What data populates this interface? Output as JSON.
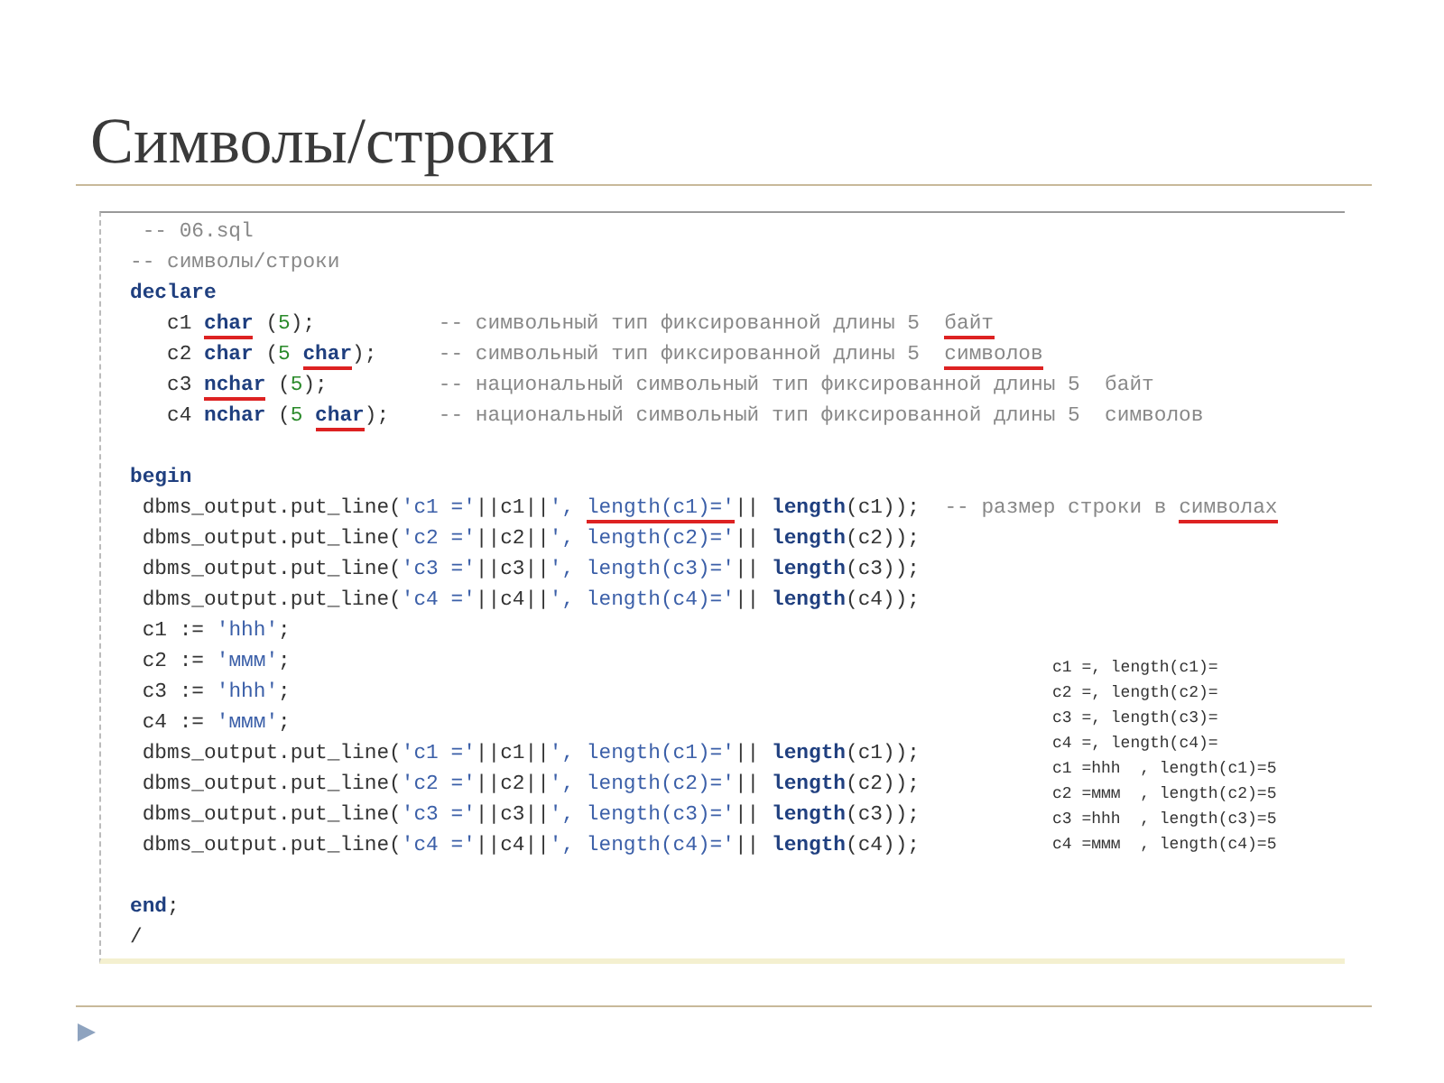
{
  "slide_title": "Символы/строки",
  "code_blocks": [
    {
      "lines": [
        {
          "tokens": [
            {
              "kind": "comment",
              "text": " -- 06.sql",
              "underlined": false
            }
          ]
        },
        {
          "tokens": [
            {
              "kind": "comment",
              "text": "-- символы/строки",
              "underlined": false
            }
          ]
        },
        {
          "tokens": [
            {
              "kind": "keyword",
              "text": "declare",
              "underlined": false
            }
          ]
        },
        {
          "tokens": [
            {
              "kind": "plain",
              "text": "   c1 ",
              "underlined": false
            },
            {
              "kind": "keyword",
              "text": "char",
              "underlined": true
            },
            {
              "kind": "plain",
              "text": " (",
              "underlined": false
            },
            {
              "kind": "number",
              "text": "5",
              "underlined": false
            },
            {
              "kind": "plain",
              "text": ");          ",
              "underlined": false
            },
            {
              "kind": "comment",
              "text": "-- символьный тип фиксированной длины 5  ",
              "underlined": false
            },
            {
              "kind": "comment",
              "text": "байт",
              "underlined": true
            }
          ]
        },
        {
          "tokens": [
            {
              "kind": "plain",
              "text": "   c2 ",
              "underlined": false
            },
            {
              "kind": "keyword",
              "text": "char",
              "underlined": false
            },
            {
              "kind": "plain",
              "text": " (",
              "underlined": false
            },
            {
              "kind": "number",
              "text": "5 ",
              "underlined": false
            },
            {
              "kind": "keyword",
              "text": "char",
              "underlined": true
            },
            {
              "kind": "plain",
              "text": ");     ",
              "underlined": false
            },
            {
              "kind": "comment",
              "text": "-- символьный тип фиксированной длины 5  ",
              "underlined": false
            },
            {
              "kind": "comment",
              "text": "символов",
              "underlined": true
            }
          ]
        },
        {
          "tokens": [
            {
              "kind": "plain",
              "text": "   c3 ",
              "underlined": false
            },
            {
              "kind": "keyword",
              "text": "nchar",
              "underlined": true
            },
            {
              "kind": "plain",
              "text": " (",
              "underlined": false
            },
            {
              "kind": "number",
              "text": "5",
              "underlined": false
            },
            {
              "kind": "plain",
              "text": ");         ",
              "underlined": false
            },
            {
              "kind": "comment",
              "text": "-- национальный символьный тип фиксированной длины 5  байт",
              "underlined": false
            }
          ]
        },
        {
          "tokens": [
            {
              "kind": "plain",
              "text": "   c4 ",
              "underlined": false
            },
            {
              "kind": "keyword",
              "text": "nchar",
              "underlined": false
            },
            {
              "kind": "plain",
              "text": " (",
              "underlined": false
            },
            {
              "kind": "number",
              "text": "5 ",
              "underlined": false
            },
            {
              "kind": "keyword",
              "text": "char",
              "underlined": true
            },
            {
              "kind": "plain",
              "text": ");    ",
              "underlined": false
            },
            {
              "kind": "comment",
              "text": "-- национальный символьный тип фиксированной длины 5  символов",
              "underlined": false
            }
          ]
        }
      ]
    },
    {
      "lines": [
        {
          "tokens": [
            {
              "kind": "keyword",
              "text": "begin",
              "underlined": false
            }
          ]
        },
        {
          "tokens": [
            {
              "kind": "plain",
              "text": " dbms_output.put_line(",
              "underlined": false
            },
            {
              "kind": "string",
              "text": "'c1 ='",
              "underlined": false
            },
            {
              "kind": "plain",
              "text": "||c1||",
              "underlined": false
            },
            {
              "kind": "string",
              "text": "', ",
              "underlined": false
            },
            {
              "kind": "string",
              "text": "length(c1)='",
              "underlined": true
            },
            {
              "kind": "plain",
              "text": "|| ",
              "underlined": false
            },
            {
              "kind": "keyword",
              "text": "length",
              "underlined": false
            },
            {
              "kind": "plain",
              "text": "(c1));  ",
              "underlined": false
            },
            {
              "kind": "comment",
              "text": "-- размер строки в ",
              "underlined": false
            },
            {
              "kind": "comment",
              "text": "символах",
              "underlined": true
            }
          ]
        },
        {
          "tokens": [
            {
              "kind": "plain",
              "text": " dbms_output.put_line(",
              "underlined": false
            },
            {
              "kind": "string",
              "text": "'c2 ='",
              "underlined": false
            },
            {
              "kind": "plain",
              "text": "||c2||",
              "underlined": false
            },
            {
              "kind": "string",
              "text": "', length(c2)='",
              "underlined": false
            },
            {
              "kind": "plain",
              "text": "|| ",
              "underlined": false
            },
            {
              "kind": "keyword",
              "text": "length",
              "underlined": false
            },
            {
              "kind": "plain",
              "text": "(c2));",
              "underlined": false
            }
          ]
        },
        {
          "tokens": [
            {
              "kind": "plain",
              "text": " dbms_output.put_line(",
              "underlined": false
            },
            {
              "kind": "string",
              "text": "'c3 ='",
              "underlined": false
            },
            {
              "kind": "plain",
              "text": "||c3||",
              "underlined": false
            },
            {
              "kind": "string",
              "text": "', length(c3)='",
              "underlined": false
            },
            {
              "kind": "plain",
              "text": "|| ",
              "underlined": false
            },
            {
              "kind": "keyword",
              "text": "length",
              "underlined": false
            },
            {
              "kind": "plain",
              "text": "(c3));",
              "underlined": false
            }
          ]
        },
        {
          "tokens": [
            {
              "kind": "plain",
              "text": " dbms_output.put_line(",
              "underlined": false
            },
            {
              "kind": "string",
              "text": "'c4 ='",
              "underlined": false
            },
            {
              "kind": "plain",
              "text": "||c4||",
              "underlined": false
            },
            {
              "kind": "string",
              "text": "', length(c4)='",
              "underlined": false
            },
            {
              "kind": "plain",
              "text": "|| ",
              "underlined": false
            },
            {
              "kind": "keyword",
              "text": "length",
              "underlined": false
            },
            {
              "kind": "plain",
              "text": "(c4));",
              "underlined": false
            }
          ]
        },
        {
          "tokens": [
            {
              "kind": "plain",
              "text": " c1 := ",
              "underlined": false
            },
            {
              "kind": "string",
              "text": "'hhh'",
              "underlined": false
            },
            {
              "kind": "plain",
              "text": ";",
              "underlined": false
            }
          ]
        },
        {
          "tokens": [
            {
              "kind": "plain",
              "text": " c2 := ",
              "underlined": false
            },
            {
              "kind": "string",
              "text": "'ммм'",
              "underlined": false
            },
            {
              "kind": "plain",
              "text": ";",
              "underlined": false
            }
          ]
        },
        {
          "tokens": [
            {
              "kind": "plain",
              "text": " c3 := ",
              "underlined": false
            },
            {
              "kind": "string",
              "text": "'hhh'",
              "underlined": false
            },
            {
              "kind": "plain",
              "text": ";",
              "underlined": false
            }
          ]
        },
        {
          "tokens": [
            {
              "kind": "plain",
              "text": " c4 := ",
              "underlined": false
            },
            {
              "kind": "string",
              "text": "'ммм'",
              "underlined": false
            },
            {
              "kind": "plain",
              "text": ";",
              "underlined": false
            }
          ]
        },
        {
          "tokens": [
            {
              "kind": "plain",
              "text": " dbms_output.put_line(",
              "underlined": false
            },
            {
              "kind": "string",
              "text": "'c1 ='",
              "underlined": false
            },
            {
              "kind": "plain",
              "text": "||c1||",
              "underlined": false
            },
            {
              "kind": "string",
              "text": "', length(c1)='",
              "underlined": false
            },
            {
              "kind": "plain",
              "text": "|| ",
              "underlined": false
            },
            {
              "kind": "keyword",
              "text": "length",
              "underlined": false
            },
            {
              "kind": "plain",
              "text": "(c1));",
              "underlined": false
            }
          ]
        },
        {
          "tokens": [
            {
              "kind": "plain",
              "text": " dbms_output.put_line(",
              "underlined": false
            },
            {
              "kind": "string",
              "text": "'c2 ='",
              "underlined": false
            },
            {
              "kind": "plain",
              "text": "||c2||",
              "underlined": false
            },
            {
              "kind": "string",
              "text": "', length(c2)='",
              "underlined": false
            },
            {
              "kind": "plain",
              "text": "|| ",
              "underlined": false
            },
            {
              "kind": "keyword",
              "text": "length",
              "underlined": false
            },
            {
              "kind": "plain",
              "text": "(c2));",
              "underlined": false
            }
          ]
        },
        {
          "tokens": [
            {
              "kind": "plain",
              "text": " dbms_output.put_line(",
              "underlined": false
            },
            {
              "kind": "string",
              "text": "'c3 ='",
              "underlined": false
            },
            {
              "kind": "plain",
              "text": "||c3||",
              "underlined": false
            },
            {
              "kind": "string",
              "text": "', length(c3)='",
              "underlined": false
            },
            {
              "kind": "plain",
              "text": "|| ",
              "underlined": false
            },
            {
              "kind": "keyword",
              "text": "length",
              "underlined": false
            },
            {
              "kind": "plain",
              "text": "(c3));",
              "underlined": false
            }
          ]
        },
        {
          "tokens": [
            {
              "kind": "plain",
              "text": " dbms_output.put_line(",
              "underlined": false
            },
            {
              "kind": "string",
              "text": "'c4 ='",
              "underlined": false
            },
            {
              "kind": "plain",
              "text": "||c4||",
              "underlined": false
            },
            {
              "kind": "string",
              "text": "', length(c4)='",
              "underlined": false
            },
            {
              "kind": "plain",
              "text": "|| ",
              "underlined": false
            },
            {
              "kind": "keyword",
              "text": "length",
              "underlined": false
            },
            {
              "kind": "plain",
              "text": "(c4));",
              "underlined": false
            }
          ]
        }
      ]
    },
    {
      "lines": [
        {
          "tokens": [
            {
              "kind": "keyword",
              "text": "end",
              "underlined": false
            },
            {
              "kind": "plain",
              "text": ";",
              "underlined": false
            }
          ]
        },
        {
          "tokens": [
            {
              "kind": "plain",
              "text": "/",
              "underlined": false
            }
          ]
        }
      ]
    }
  ],
  "output_lines": [
    "c1 =, length(c1)=",
    "c2 =, length(c2)=",
    "c3 =, length(c3)=",
    "c4 =, length(c4)=",
    "c1 =hhh  , length(c1)=5",
    "c2 =ммм  , length(c2)=5",
    "c3 =hhh  , length(c3)=5",
    "c4 =ммм  , length(c4)=5"
  ]
}
